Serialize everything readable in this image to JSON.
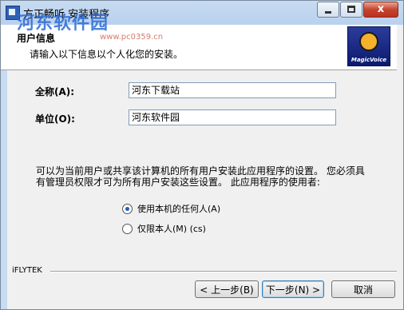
{
  "window": {
    "title": "方正畅听 安装程序",
    "close_glyph": "x"
  },
  "watermark": {
    "site": "河东软件园",
    "url": "www.pc0359.cn"
  },
  "header": {
    "title": "用户信息",
    "subtitle": "请输入以下信息以个人化您的安装。",
    "logo_text": "MagicVoice"
  },
  "form": {
    "fullname_label": "全称(A):",
    "fullname_value": "河东下载站",
    "org_label": "单位(O):",
    "org_value": "河东软件园"
  },
  "notice": {
    "text": "可以为当前用户或共享该计算机的所有用户安装此应用程序的设置。 您必须具有管理员权限才可为所有用户安装这些设置。 此应用程序的使用者:"
  },
  "options": [
    {
      "label": "使用本机的任何人(A)",
      "checked": true
    },
    {
      "label": "仅限本人(M) (cs)",
      "checked": false
    }
  ],
  "footer": {
    "brand": "iFLYTEK",
    "prev_label": "< 上一步(B)",
    "next_label": "下一步(N) >",
    "cancel_label": "取消"
  }
}
